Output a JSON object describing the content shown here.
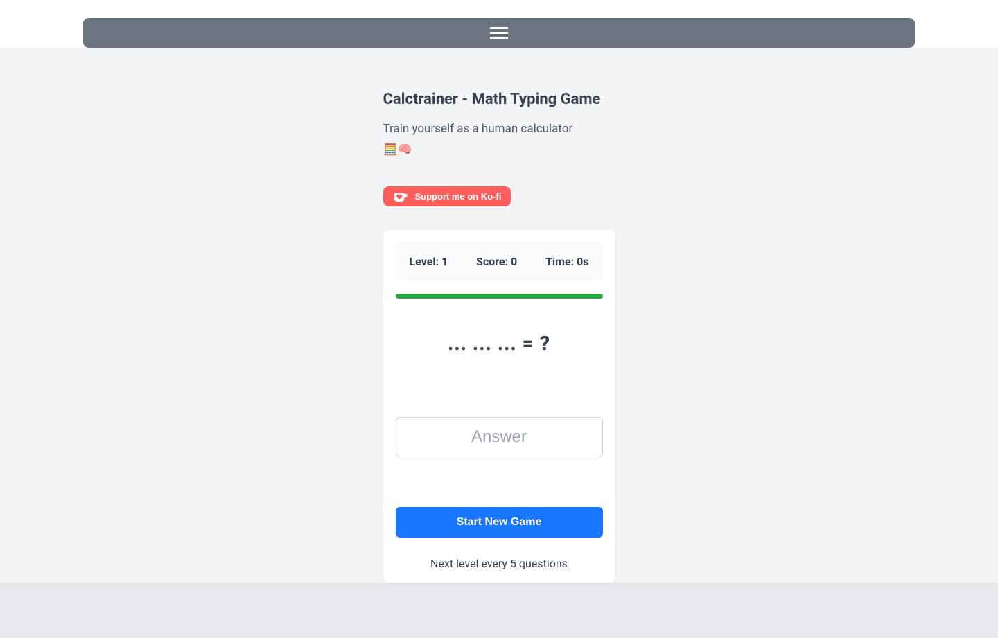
{
  "header": {
    "title": "Calctrainer - Math Typing Game",
    "subtitle_line1": "Train yourself as a human calculator",
    "subtitle_line2": "🧮🧠"
  },
  "kofi": {
    "label": "Support me on Ko-fi"
  },
  "game": {
    "stats": {
      "level_label": "Level:",
      "level_value": "1",
      "score_label": "Score:",
      "score_value": "0",
      "time_label": "Time:",
      "time_value": "0s"
    },
    "progress_percent": 100,
    "question": "... ... ... = ?",
    "answer_placeholder": "Answer",
    "start_button": "Start New Game",
    "hint": "Next level every 5 questions"
  }
}
